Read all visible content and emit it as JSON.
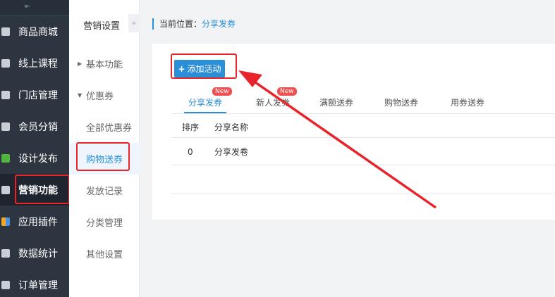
{
  "sidebar": {
    "collapse_icon": "collapse-left-icon",
    "items": [
      {
        "label": "商品商城",
        "icon": "shop-icon"
      },
      {
        "label": "线上课程",
        "icon": "users-icon"
      },
      {
        "label": "门店管理",
        "icon": "store-icon"
      },
      {
        "label": "会员分销",
        "icon": "user-icon"
      },
      {
        "label": "设计发布",
        "icon": "design-icon"
      },
      {
        "label": "营销功能",
        "icon": "gift-icon"
      },
      {
        "label": "应用插件",
        "icon": "plugin-icon"
      },
      {
        "label": "数据统计",
        "icon": "chart-icon"
      },
      {
        "label": "订单管理",
        "icon": "order-icon"
      }
    ]
  },
  "subnav": {
    "title": "营销设置",
    "collapse": "«",
    "items": [
      {
        "label": "基本功能"
      },
      {
        "label": "优惠券"
      },
      {
        "label": "全部优惠券"
      },
      {
        "label": "购物送券"
      },
      {
        "label": "发放记录"
      },
      {
        "label": "分类管理"
      },
      {
        "label": "其他设置"
      }
    ]
  },
  "breadcrumb": {
    "prefix": "当前位置：",
    "current": "分享发券"
  },
  "toolbar": {
    "add_label": "添加活动",
    "plus": "+"
  },
  "tabs": [
    {
      "label": "分享发券",
      "badge": "New"
    },
    {
      "label": "新人发券",
      "badge": "New"
    },
    {
      "label": "满额送券"
    },
    {
      "label": "购物送券"
    },
    {
      "label": "用券送券"
    }
  ],
  "table": {
    "headers": [
      "排序",
      "分享名称"
    ],
    "rows": [
      [
        "0",
        "分享发卷"
      ]
    ]
  },
  "colors": {
    "accent": "#2b8fd8",
    "sidebar_bg": "#2d3540",
    "highlight": "#e8242b",
    "badge": "#f05050"
  }
}
